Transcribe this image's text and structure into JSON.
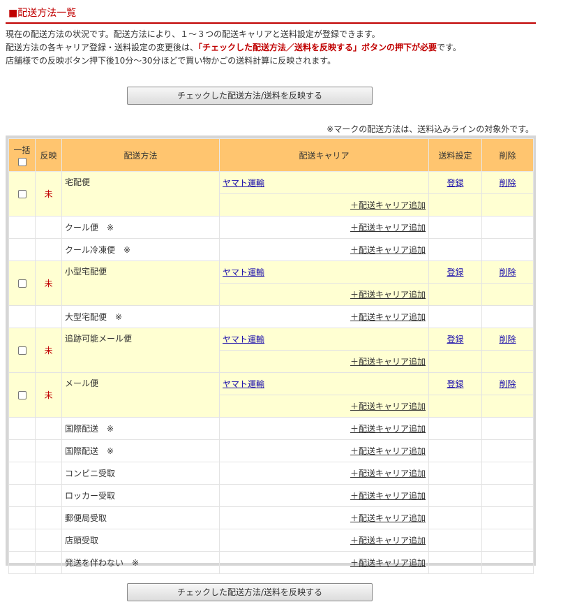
{
  "page": {
    "title": "■配送方法一覧",
    "desc_line1": "現在の配送方法の状況です。配送方法により、１～３つの配送キャリアと送料設定が登録できます。",
    "desc_line2_a": "配送方法の各キャリア登録・送料設定の変更後は、",
    "desc_line2_b": "「チェックした配送方法／送料を反映する」ボタンの押下が必要",
    "desc_line2_c": "です。",
    "desc_line3": "店舗様での反映ボタン押下後10分～30分ほどで買い物かごの送料計算に反映されます。",
    "apply_button": "チェックした配送方法/送料を反映する",
    "note": "※マークの配送方法は、送料込みラインの対象外です。",
    "colors": {
      "accent": "#c00000",
      "header_bg": "#ffc56f",
      "row_highlight": "#ffffd2"
    }
  },
  "table": {
    "headers": {
      "bulk": "一括",
      "reflect": "反映",
      "method": "配送方法",
      "carrier": "配送キャリア",
      "fee": "送料設定",
      "delete": "削除"
    },
    "status_text": "未",
    "carrier_name": "ヤマト運輸",
    "register_link": "登録",
    "delete_link": "削除",
    "add_carrier": "＋配送キャリア追加",
    "methods": {
      "m1": "宅配便",
      "m2": "クール便　※",
      "m3": "クール冷凍便　※",
      "m4": "小型宅配便",
      "m5": "大型宅配便　※",
      "m6": "追跡可能メール便",
      "m7": "メール便",
      "m8": "国際配送　※",
      "m9": "国際配送　※",
      "m10": "コンビニ受取",
      "m11": "ロッカー受取",
      "m12": "郵便局受取",
      "m13": "店頭受取",
      "m14": "発送を伴わない　※"
    }
  }
}
